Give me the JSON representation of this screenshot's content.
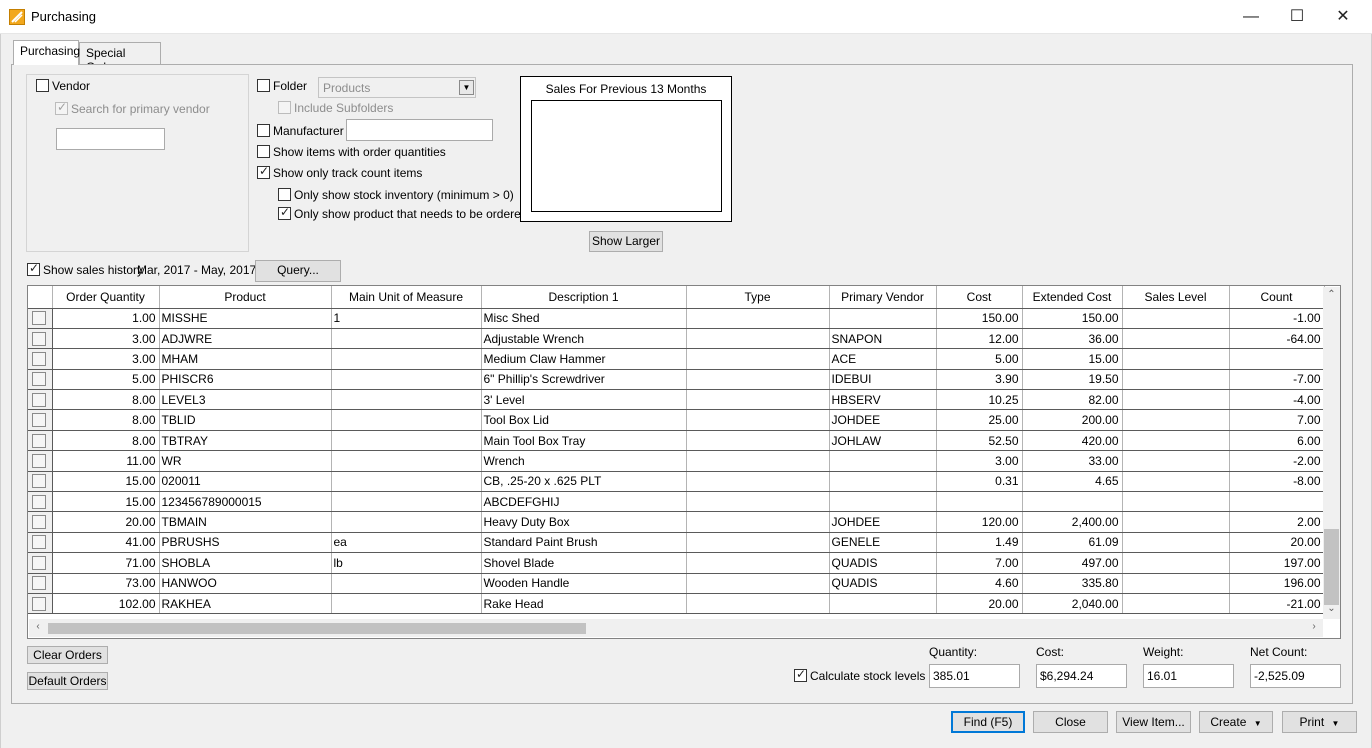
{
  "window": {
    "title": "Purchasing",
    "minimize_glyph": "—",
    "maximize_glyph": "☐",
    "close_glyph": "✕"
  },
  "tabs": [
    {
      "label": "Purchasing",
      "active": true
    },
    {
      "label": "Special Orders",
      "active": false
    }
  ],
  "filters": {
    "vendor_label": "Vendor",
    "vendor_checked": false,
    "search_primary_vendor_label": "Search for primary vendor",
    "search_primary_vendor_checked": true,
    "vendor_value": "",
    "folder_label": "Folder",
    "folder_checked": false,
    "folder_value": "Products",
    "include_subfolders_label": "Include Subfolders",
    "manufacturer_label": "Manufacturer",
    "manufacturer_value": "",
    "show_order_qty_label": "Show items with order quantities",
    "show_track_count_label": "Show only track count items",
    "stock_inventory_label": "Only show stock inventory (minimum > 0)",
    "needs_order_label": "Only show product that needs to be ordered",
    "sales_history_label": "Show sales history",
    "sales_history_range": "Mar, 2017 - May, 2017",
    "query_label": "Query..."
  },
  "sales_panel": {
    "title": "Sales For Previous 13 Months",
    "show_larger_label": "Show Larger"
  },
  "grid": {
    "columns": [
      "Order Quantity",
      "Product",
      "Main Unit of Measure",
      "Description 1",
      "Type",
      "Primary Vendor",
      "Cost",
      "Extended Cost",
      "Sales Level",
      "Count"
    ],
    "rows": [
      [
        "1.00",
        "MISSHE",
        "1",
        "Misc Shed",
        "",
        "",
        "150.00",
        "150.00",
        "",
        "-1.00"
      ],
      [
        "3.00",
        "ADJWRE",
        "",
        "Adjustable Wrench",
        "",
        "SNAPON",
        "12.00",
        "36.00",
        "",
        "-64.00"
      ],
      [
        "3.00",
        "MHAM",
        "",
        "Medium Claw Hammer",
        "",
        "ACE",
        "5.00",
        "15.00",
        "",
        ""
      ],
      [
        "5.00",
        "PHISCR6",
        "",
        "6\" Phillip's Screwdriver",
        "",
        "IDEBUI",
        "3.90",
        "19.50",
        "",
        "-7.00"
      ],
      [
        "8.00",
        "LEVEL3",
        "",
        "3' Level",
        "",
        "HBSERV",
        "10.25",
        "82.00",
        "",
        "-4.00"
      ],
      [
        "8.00",
        "TBLID",
        "",
        "Tool Box Lid",
        "",
        "JOHDEE",
        "25.00",
        "200.00",
        "",
        "7.00"
      ],
      [
        "8.00",
        "TBTRAY",
        "",
        "Main Tool Box Tray",
        "",
        "JOHLAW",
        "52.50",
        "420.00",
        "",
        "6.00"
      ],
      [
        "11.00",
        "WR",
        "",
        "Wrench",
        "",
        "",
        "3.00",
        "33.00",
        "",
        "-2.00"
      ],
      [
        "15.00",
        "020011",
        "",
        "CB, .25-20 x .625 PLT",
        "",
        "",
        "0.31",
        "4.65",
        "",
        "-8.00"
      ],
      [
        "15.00",
        "123456789000015",
        "",
        "ABCDEFGHIJ",
        "",
        "",
        "",
        "",
        "",
        ""
      ],
      [
        "20.00",
        "TBMAIN",
        "",
        "Heavy Duty Box",
        "",
        "JOHDEE",
        "120.00",
        "2,400.00",
        "",
        "2.00"
      ],
      [
        "41.00",
        "PBRUSHS",
        "ea",
        "Standard Paint Brush",
        "",
        "GENELE",
        "1.49",
        "61.09",
        "",
        "20.00"
      ],
      [
        "71.00",
        "SHOBLA",
        "lb",
        "Shovel Blade",
        "",
        "QUADIS",
        "7.00",
        "497.00",
        "",
        "197.00"
      ],
      [
        "73.00",
        "HANWOO",
        "",
        "Wooden Handle",
        "",
        "QUADIS",
        "4.60",
        "335.80",
        "",
        "196.00"
      ],
      [
        "102.00",
        "RAKHEA",
        "",
        "Rake Head",
        "",
        "",
        "20.00",
        "2,040.00",
        "",
        "-21.00"
      ]
    ]
  },
  "bottom": {
    "clear_orders_label": "Clear Orders",
    "default_orders_label": "Default Orders",
    "calculate_stock_label": "Calculate stock levels",
    "quantity_label": "Quantity:",
    "quantity_value": "385.01",
    "cost_label": "Cost:",
    "cost_value": "$6,294.24",
    "weight_label": "Weight:",
    "weight_value": "16.01",
    "net_count_label": "Net Count:",
    "net_count_value": "-2,525.09"
  },
  "footer_buttons": {
    "find_label": "Find (F5)",
    "close_label": "Close",
    "view_item_label": "View Item...",
    "create_label": "Create",
    "print_label": "Print"
  }
}
